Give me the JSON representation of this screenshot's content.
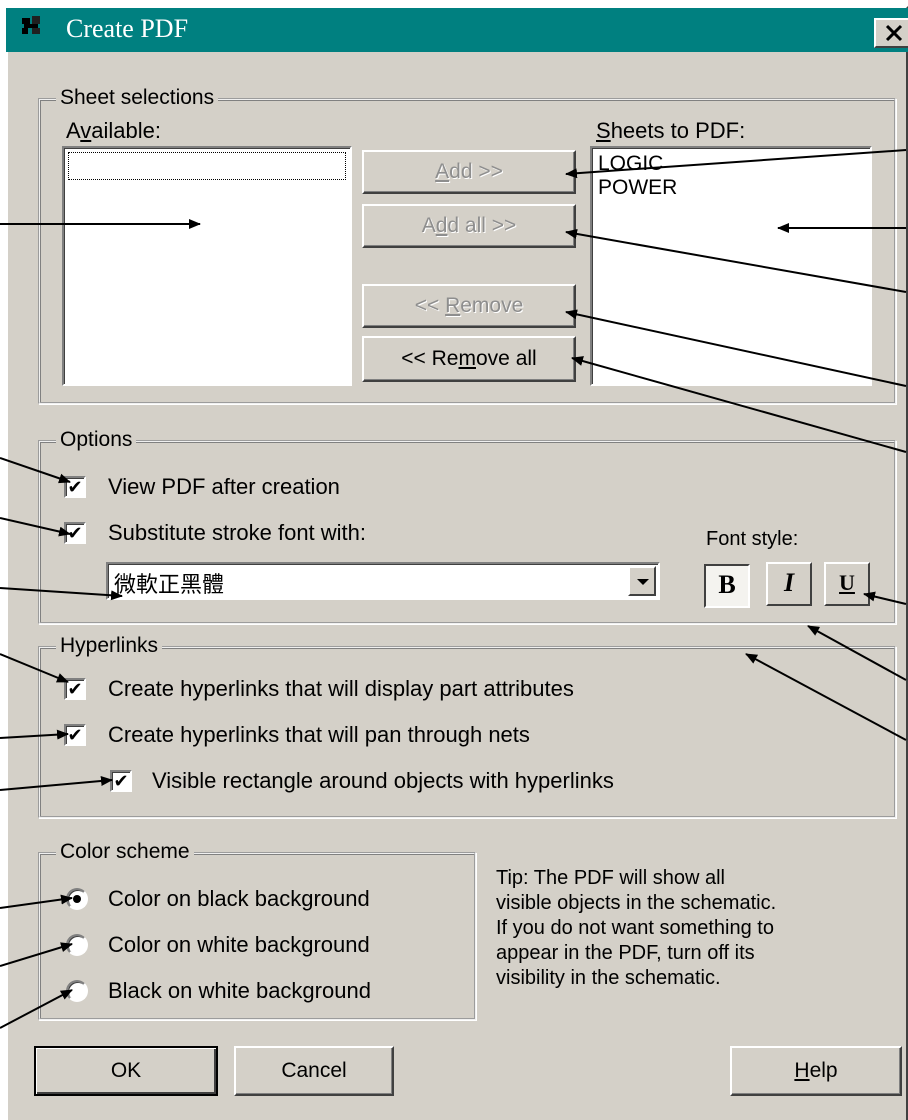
{
  "window": {
    "title": "Create PDF",
    "close_label": "✕"
  },
  "sheet_selections": {
    "legend": "Sheet selections",
    "available_label": "Available:",
    "sheets_to_pdf_label": "Sheets to PDF:",
    "sheets_to_pdf_items": [
      "LOGIC",
      "POWER"
    ],
    "add_button": "Add >>",
    "add_all_button": "Add all >>",
    "remove_button": "<< Remove",
    "remove_all_button": "<< Remove all"
  },
  "options": {
    "legend": "Options",
    "view_pdf_label": "View PDF after creation",
    "view_pdf_checked": true,
    "substitute_label": "Substitute stroke font with:",
    "substitute_checked": true,
    "font_value": "微軟正黑體",
    "font_style_label": "Font style:",
    "bold_label": "B",
    "italic_label": "I",
    "underline_label": "U"
  },
  "hyperlinks": {
    "legend": "Hyperlinks",
    "part_attributes_label": "Create hyperlinks that will display part attributes",
    "pan_nets_label": "Create hyperlinks that will pan through nets",
    "visible_rect_label": "Visible rectangle around objects with hyperlinks",
    "check_mark": "✔"
  },
  "color_scheme": {
    "legend": "Color scheme",
    "options": [
      "Color on black background",
      "Color on white background",
      "Black on white background"
    ],
    "selected": "Color on black background"
  },
  "tip": {
    "lines": [
      "Tip: The PDF will show all",
      "visible objects in the schematic.",
      "If you do not want something to",
      "appear in the PDF, turn off its",
      "visibility in the schematic."
    ]
  },
  "footer": {
    "ok": "OK",
    "cancel": "Cancel",
    "help": "Help"
  },
  "colors": {
    "title_bar": "#008080",
    "dialog_bg": "#d4d0c8",
    "disabled_text": "#8e8e8e"
  }
}
